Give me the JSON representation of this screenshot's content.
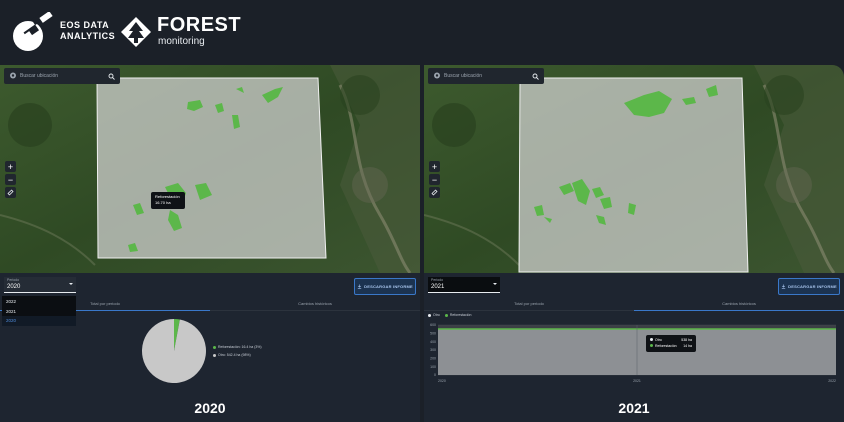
{
  "header": {
    "eos_brand_line1": "EOS DATA",
    "eos_brand_line2": "ANALYTICS",
    "product_title": "FOREST",
    "product_subtitle": "monitoring"
  },
  "search": {
    "placeholder": "Buscar ubicación"
  },
  "map_controls": {
    "zoom_in": "+",
    "zoom_out": "−"
  },
  "left": {
    "map_tooltip": {
      "label": "Reforestación",
      "value": "16.70 ha"
    },
    "period": {
      "label": "Periodo",
      "value": "2020"
    },
    "dropdown_options": [
      "2022",
      "2021",
      "2020"
    ],
    "download_label": "DESCARGAR INFORME",
    "tabs": [
      "Total por periodo",
      "Cambios históricos"
    ],
    "pie": {
      "legend": [
        {
          "label": "Reforestación: 16.4 ha (3%)",
          "color": "#5cb74a"
        },
        {
          "label": "Otro: 542.4 ha (98%)",
          "color": "#c8c8c8"
        }
      ]
    },
    "year_label": "2020"
  },
  "right": {
    "period": {
      "label": "Periodo",
      "value": "2021"
    },
    "download_label": "DESCARGAR INFORME",
    "tabs": [
      "Total por periodo",
      "Cambios históricos"
    ],
    "chart_legend": [
      {
        "label": "Otro",
        "color": "#e8ecf0"
      },
      {
        "label": "Reforestación",
        "color": "#5cb74a"
      }
    ],
    "chart_tip": [
      {
        "label": "Otro",
        "value": "538 ha",
        "color": "#e8ecf0"
      },
      {
        "label": "Reforestación",
        "value": "14 ha",
        "color": "#5cb74a"
      }
    ],
    "year_label": "2021"
  },
  "chart_data": [
    {
      "type": "pie",
      "slices": [
        {
          "name": "Reforestación",
          "value": 16.4,
          "percent": 3,
          "color": "#5cb74a"
        },
        {
          "name": "Otro",
          "value": 542.4,
          "percent": 98,
          "color": "#c8c8c8"
        }
      ]
    },
    {
      "type": "area",
      "x": [
        "2020",
        "2021",
        "2022"
      ],
      "y_ticks": [
        0,
        100,
        200,
        300,
        400,
        500,
        600
      ],
      "ylim": [
        0,
        600
      ],
      "series": [
        {
          "name": "Otro",
          "values": [
            538,
            538,
            538
          ],
          "color": "#8d9094"
        },
        {
          "name": "Reforestación",
          "values": [
            14,
            14,
            14
          ],
          "color": "#5cb74a"
        }
      ]
    }
  ]
}
